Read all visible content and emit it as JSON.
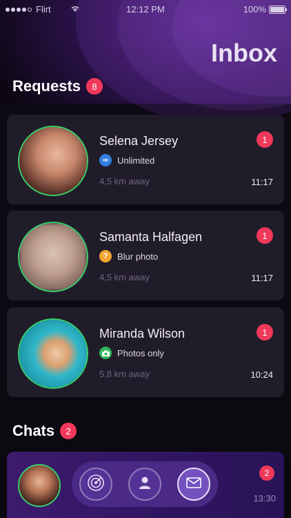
{
  "status_bar": {
    "carrier": "Flirt",
    "time": "12:12 PM",
    "battery": "100%"
  },
  "page_title": "Inbox",
  "requests": {
    "label": "Requests",
    "count": "8",
    "items": [
      {
        "name": "Selena Jersey",
        "permission": "Unlimited",
        "permission_icon": "infinity-icon",
        "permission_color": "#2f7fe0",
        "distance": "4,5 km away",
        "unread": "1",
        "time": "11:17"
      },
      {
        "name": "Samanta Halfagen",
        "permission": "Blur photo",
        "permission_icon": "question-icon",
        "permission_color": "#f2a531",
        "distance": "4,5 km away",
        "unread": "1",
        "time": "11:17"
      },
      {
        "name": "Miranda Wilson",
        "permission": "Photos only",
        "permission_icon": "camera-icon",
        "permission_color": "#2fb85c",
        "distance": "5,8 km away",
        "unread": "1",
        "time": "10:24"
      }
    ]
  },
  "chats": {
    "label": "Chats",
    "count": "2",
    "items": [
      {
        "unread": "2",
        "time": "13:30"
      }
    ]
  },
  "tab_bar": [
    {
      "icon": "radar-icon",
      "active": false
    },
    {
      "icon": "profile-icon",
      "active": false
    },
    {
      "icon": "mail-icon",
      "active": true
    }
  ],
  "colors": {
    "accent_badge": "#f0395a",
    "online_ring": "#39d06b",
    "card_bg": "#211c2a"
  }
}
